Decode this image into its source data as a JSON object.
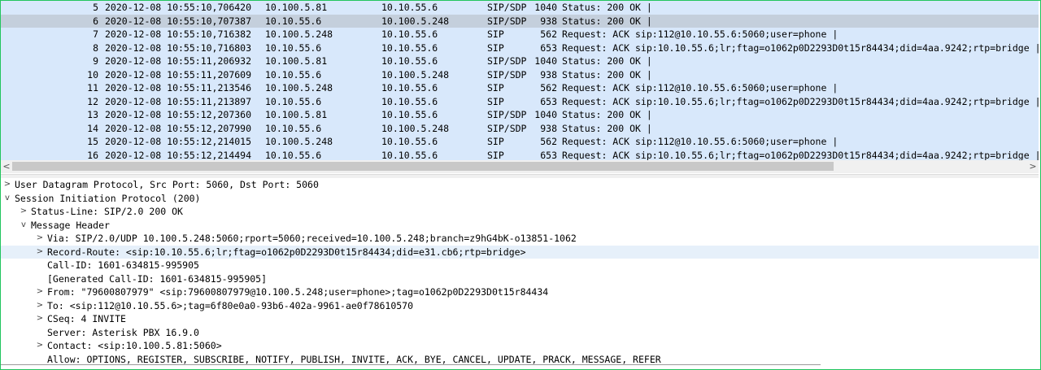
{
  "packets": [
    {
      "no": "5",
      "time": "2020-12-08 10:55:10,706420",
      "src": "10.100.5.81",
      "dst": "10.10.55.6",
      "proto": "SIP/SDP",
      "len": "1040",
      "info": "Status: 200 OK",
      "bar": "|",
      "selected": false
    },
    {
      "no": "6",
      "time": "2020-12-08 10:55:10,707387",
      "src": "10.10.55.6",
      "dst": "10.100.5.248",
      "proto": "SIP/SDP",
      "len": "938",
      "info": "Status: 200 OK",
      "bar": "|",
      "selected": true
    },
    {
      "no": "7",
      "time": "2020-12-08 10:55:10,716382",
      "src": "10.100.5.248",
      "dst": "10.10.55.6",
      "proto": "SIP",
      "len": "562",
      "info": "Request: ACK sip:112@10.10.55.6:5060;user=phone",
      "bar": "|",
      "selected": false
    },
    {
      "no": "8",
      "time": "2020-12-08 10:55:10,716803",
      "src": "10.10.55.6",
      "dst": "10.10.55.6",
      "proto": "SIP",
      "len": "653",
      "info": "Request: ACK sip:10.10.55.6;lr;ftag=o1062p0D2293D0t15r84434;did=4aa.9242;rtp=bridge",
      "bar": "|",
      "selected": false
    },
    {
      "no": "9",
      "time": "2020-12-08 10:55:11,206932",
      "src": "10.100.5.81",
      "dst": "10.10.55.6",
      "proto": "SIP/SDP",
      "len": "1040",
      "info": "Status: 200 OK",
      "bar": "|",
      "selected": false
    },
    {
      "no": "10",
      "time": "2020-12-08 10:55:11,207609",
      "src": "10.10.55.6",
      "dst": "10.100.5.248",
      "proto": "SIP/SDP",
      "len": "938",
      "info": "Status: 200 OK",
      "bar": "|",
      "selected": false
    },
    {
      "no": "11",
      "time": "2020-12-08 10:55:11,213546",
      "src": "10.100.5.248",
      "dst": "10.10.55.6",
      "proto": "SIP",
      "len": "562",
      "info": "Request: ACK sip:112@10.10.55.6:5060;user=phone",
      "bar": "|",
      "selected": false
    },
    {
      "no": "12",
      "time": "2020-12-08 10:55:11,213897",
      "src": "10.10.55.6",
      "dst": "10.10.55.6",
      "proto": "SIP",
      "len": "653",
      "info": "Request: ACK sip:10.10.55.6;lr;ftag=o1062p0D2293D0t15r84434;did=4aa.9242;rtp=bridge",
      "bar": "|",
      "selected": false
    },
    {
      "no": "13",
      "time": "2020-12-08 10:55:12,207360",
      "src": "10.100.5.81",
      "dst": "10.10.55.6",
      "proto": "SIP/SDP",
      "len": "1040",
      "info": "Status: 200 OK",
      "bar": "|",
      "selected": false
    },
    {
      "no": "14",
      "time": "2020-12-08 10:55:12,207990",
      "src": "10.10.55.6",
      "dst": "10.100.5.248",
      "proto": "SIP/SDP",
      "len": "938",
      "info": "Status: 200 OK",
      "bar": "|",
      "selected": false
    },
    {
      "no": "15",
      "time": "2020-12-08 10:55:12,214015",
      "src": "10.100.5.248",
      "dst": "10.10.55.6",
      "proto": "SIP",
      "len": "562",
      "info": "Request: ACK sip:112@10.10.55.6:5060;user=phone",
      "bar": "|",
      "selected": false
    },
    {
      "no": "16",
      "time": "2020-12-08 10:55:12,214494",
      "src": "10.10.55.6",
      "dst": "10.10.55.6",
      "proto": "SIP",
      "len": "653",
      "info": "Request: ACK sip:10.10.55.6;lr;ftag=o1062p0D2293D0t15r84434;did=4aa.9242;rtp=bridge",
      "bar": "|",
      "selected": false
    }
  ],
  "scrollbar": {
    "left_arrow": "<",
    "right_arrow": ">"
  },
  "details": [
    {
      "level": 0,
      "toggle": "collapsed",
      "text": "User Datagram Protocol, Src Port: 5060, Dst Port: 5060",
      "highlight": false
    },
    {
      "level": 0,
      "toggle": "expanded",
      "text": "Session Initiation Protocol (200)",
      "highlight": false
    },
    {
      "level": 1,
      "toggle": "collapsed",
      "text": "Status-Line: SIP/2.0 200 OK",
      "highlight": false
    },
    {
      "level": 1,
      "toggle": "expanded",
      "text": "Message Header",
      "highlight": false
    },
    {
      "level": 2,
      "toggle": "collapsed",
      "text": "Via: SIP/2.0/UDP 10.100.5.248:5060;rport=5060;received=10.100.5.248;branch=z9hG4bK-o13851-1062",
      "highlight": false
    },
    {
      "level": 2,
      "toggle": "collapsed",
      "text": "Record-Route: <sip:10.10.55.6;lr;ftag=o1062p0D2293D0t15r84434;did=e31.cb6;rtp=bridge>",
      "highlight": true
    },
    {
      "level": 2,
      "toggle": "none",
      "text": "Call-ID: 1601-634815-995905",
      "highlight": false
    },
    {
      "level": 2,
      "toggle": "none",
      "text": "[Generated Call-ID: 1601-634815-995905]",
      "highlight": false
    },
    {
      "level": 2,
      "toggle": "collapsed",
      "text": "From: \"79600807979\" <sip:79600807979@10.100.5.248;user=phone>;tag=o1062p0D2293D0t15r84434",
      "highlight": false
    },
    {
      "level": 2,
      "toggle": "collapsed",
      "text": "To: <sip:112@10.10.55.6>;tag=6f80e0a0-93b6-402a-9961-ae0f78610570",
      "highlight": false
    },
    {
      "level": 2,
      "toggle": "collapsed",
      "text": "CSeq: 4 INVITE",
      "highlight": false
    },
    {
      "level": 2,
      "toggle": "none",
      "text": "Server: Asterisk PBX 16.9.0",
      "highlight": false
    },
    {
      "level": 2,
      "toggle": "collapsed",
      "text": "Contact: <sip:10.100.5.81:5060>",
      "highlight": false
    },
    {
      "level": 2,
      "toggle": "none",
      "text": "Allow: OPTIONS, REGISTER, SUBSCRIBE, NOTIFY, PUBLISH, INVITE, ACK, BYE, CANCEL, UPDATE, PRACK, MESSAGE, REFER",
      "highlight": false
    }
  ],
  "glyphs": {
    "collapsed": ">",
    "expanded": "v"
  }
}
